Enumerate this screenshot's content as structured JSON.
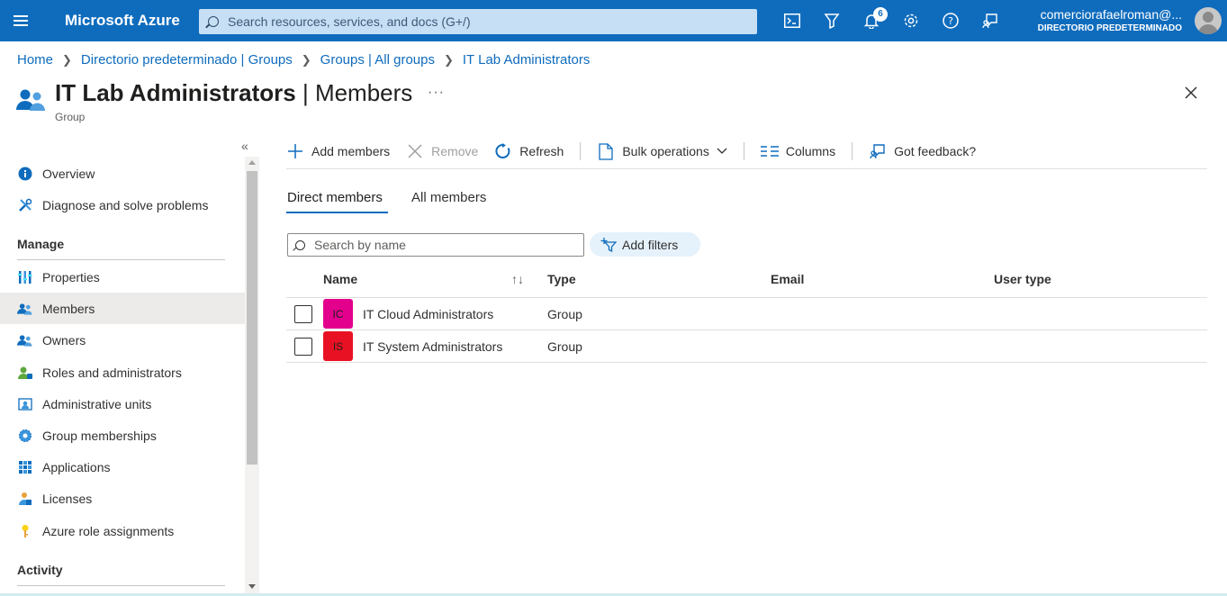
{
  "topbar": {
    "brand": "Microsoft Azure",
    "search_placeholder": "Search resources, services, and docs (G+/)",
    "notification_count": "6",
    "account_email": "comerciorafaelroman@...",
    "account_directory": "DIRECTORIO PREDETERMINADO",
    "icons": [
      "cloud-shell-icon",
      "directory-filter-icon",
      "notifications-icon",
      "settings-icon",
      "help-icon",
      "feedback-icon"
    ]
  },
  "breadcrumb": [
    "Home",
    "Directorio predeterminado | Groups",
    "Groups | All groups",
    "IT Lab Administrators"
  ],
  "header": {
    "title_main": "IT Lab Administrators",
    "title_section": "Members",
    "title_sep": " | ",
    "more": "···",
    "subtitle": "Group"
  },
  "sidebar": {
    "items_top": [
      {
        "label": "Overview",
        "icon": "info-icon"
      },
      {
        "label": "Diagnose and solve problems",
        "icon": "tools-icon"
      }
    ],
    "manage_header": "Manage",
    "manage_items": [
      {
        "label": "Properties",
        "icon": "properties-icon"
      },
      {
        "label": "Members",
        "icon": "members-icon",
        "selected": true
      },
      {
        "label": "Owners",
        "icon": "owners-icon"
      },
      {
        "label": "Roles and administrators",
        "icon": "roles-icon"
      },
      {
        "label": "Administrative units",
        "icon": "admin-units-icon"
      },
      {
        "label": "Group memberships",
        "icon": "group-memberships-icon"
      },
      {
        "label": "Applications",
        "icon": "applications-icon"
      },
      {
        "label": "Licenses",
        "icon": "licenses-icon"
      },
      {
        "label": "Azure role assignments",
        "icon": "key-icon"
      }
    ],
    "activity_header": "Activity"
  },
  "toolbar": {
    "add_members": "Add members",
    "remove": "Remove",
    "refresh": "Refresh",
    "bulk_operations": "Bulk operations",
    "columns": "Columns",
    "feedback": "Got feedback?"
  },
  "tabs": {
    "direct": "Direct members",
    "all": "All members"
  },
  "filters": {
    "search_placeholder": "Search by name",
    "add_filters": "Add filters"
  },
  "table": {
    "columns": [
      "Name",
      "Type",
      "Email",
      "User type"
    ],
    "sort_indicator": "↑↓",
    "rows": [
      {
        "initials": "IC",
        "name": "IT Cloud Administrators",
        "type": "Group",
        "tile_color": "#e3008c"
      },
      {
        "initials": "IS",
        "name": "IT System Administrators",
        "type": "Group",
        "tile_color": "#e81123"
      }
    ]
  },
  "colors": {
    "accent": "#0f6cbd",
    "selected_nav": "#edebe9"
  }
}
